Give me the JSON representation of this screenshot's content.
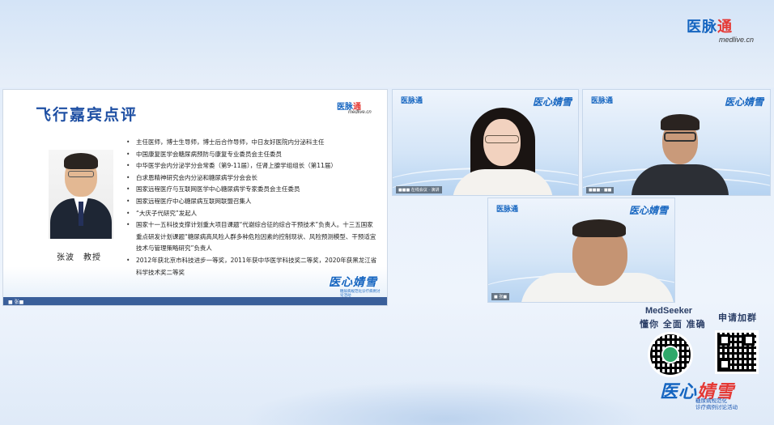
{
  "brand": {
    "name_blue": "医脉",
    "name_red": "通",
    "domain": "medlive.cn"
  },
  "slide": {
    "title": "飞行嘉宾点评",
    "logo_blue": "医脉",
    "logo_red": "通",
    "logo_sub": "medlive.cn",
    "speaker_name": "张波　教授",
    "bio": [
      "主任医师，博士生导师，博士后合作导师，中日友好医院内分泌科主任",
      "中国康复医学会糖尿病预防与康复专业委员会主任委员",
      "中华医学会内分泌学分会常委（第9-11届），任肾上腺学组组长（第11届）",
      "白求恩精神研究会内分泌和糖尿病学分会会长",
      "国家远程医疗与互联网医学中心糖尿病学专家委员会主任委员",
      "国家远程医疗中心糖尿病互联网联盟召集人",
      "“大庆子代研究”发起人",
      "国家十一五科技支撑计划重大项目课题“代谢综合征的综合干预技术”负责人。十三五国家重点研发计划课题“糖尿病高风险人群多种危险因素的控制现状、风险预测模型、干预适宜技术与管理策略研究”负责人",
      "2012年获北京市科技进步一等奖，2011年获中华医学科技奖二等奖，2020年获黑龙江省科学技术奖二等奖"
    ],
    "badge": "医心婧雪",
    "badge_sub": "糖尿病规范化诊疗病例讨论活动"
  },
  "tiles": [
    {
      "id": "tile-1",
      "logo_left": "医脉通",
      "logo_right": "医心婧雪",
      "name": "■■■ 在线会议 · 演讲"
    },
    {
      "id": "tile-2",
      "logo_left": "医脉通",
      "logo_right": "医心婧雪",
      "name": "■■■ · ■■"
    },
    {
      "id": "tile-3",
      "logo_left": "医脉通",
      "logo_right": "医心婧雪",
      "name": "■ 张■"
    }
  ],
  "qr": {
    "medseeker": "MedSeeker",
    "medseeker_slogan": "懂你 全面 准确",
    "join_group": "申请加群"
  },
  "event": {
    "name_blue": "医心",
    "name_red": "婧雪",
    "sub_line1": "糖尿病规范化",
    "sub_line2": "诊疗病例讨论活动"
  }
}
